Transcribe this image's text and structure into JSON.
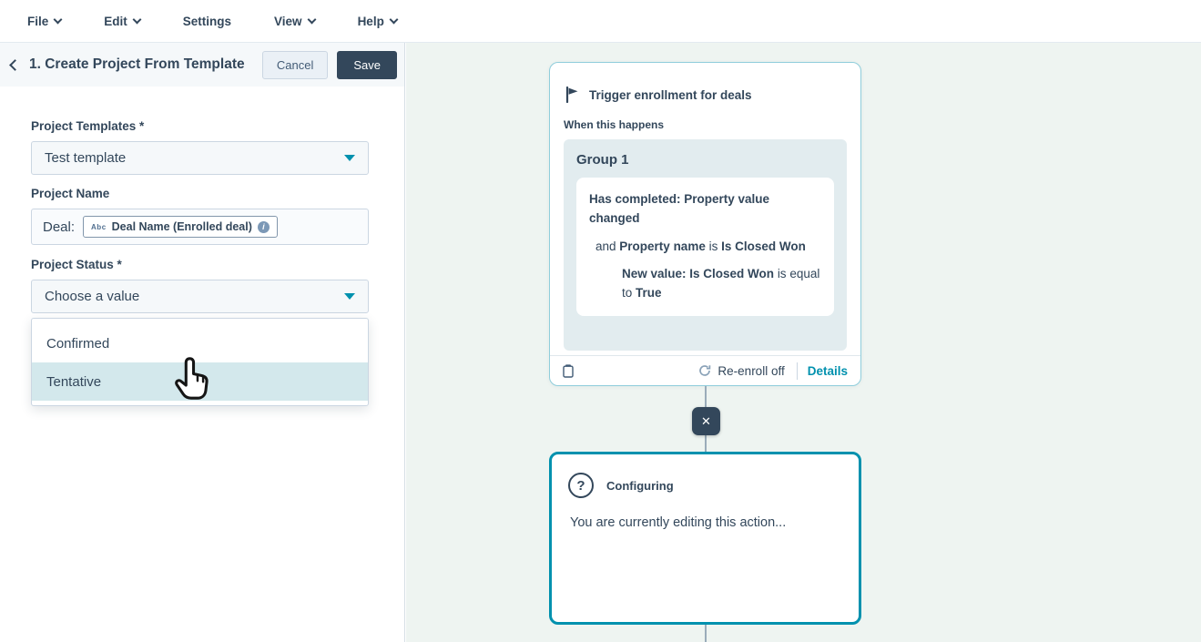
{
  "menu": {
    "items": [
      {
        "label": "File"
      },
      {
        "label": "Edit"
      },
      {
        "label": "Settings"
      },
      {
        "label": "View"
      },
      {
        "label": "Help"
      }
    ]
  },
  "panel": {
    "title": "1. Create Project From Template",
    "cancel_label": "Cancel",
    "save_label": "Save",
    "form": {
      "templates_label": "Project Templates *",
      "templates_value": "Test template",
      "name_label": "Project Name",
      "name_prefix": "Deal:",
      "token_type_glyph": "Abc",
      "token_label": "Deal Name (Enrolled deal)",
      "info_glyph": "i",
      "status_label": "Project Status *",
      "status_value": "Choose a value",
      "options": [
        {
          "label": "Confirmed"
        },
        {
          "label": "Tentative"
        }
      ]
    }
  },
  "canvas": {
    "trigger": {
      "title": "Trigger enrollment for deals",
      "when_label": "When this happens",
      "group_title": "Group 1",
      "condition1": "Has completed: Property value changed",
      "condition2": {
        "prefix": "and",
        "bold1": "Property name",
        "mid": "is",
        "bold2": "Is Closed Won"
      },
      "condition3": {
        "bold1": "New value: Is Closed Won",
        "mid": "is equal to",
        "bold2": "True"
      },
      "reenroll_label": "Re-enroll off",
      "details_label": "Details"
    },
    "delete_node_glyph": "✕",
    "configuring": {
      "icon_glyph": "?",
      "title": "Configuring",
      "body": "You are currently editing this action..."
    }
  },
  "colors": {
    "navy": "#33475b",
    "accent": "#0091ae",
    "canvas_bg": "#eef4f1",
    "option_highlight": "#d3e8ec",
    "trigger_border": "#8fcddb",
    "save_bg": "#33475b"
  }
}
